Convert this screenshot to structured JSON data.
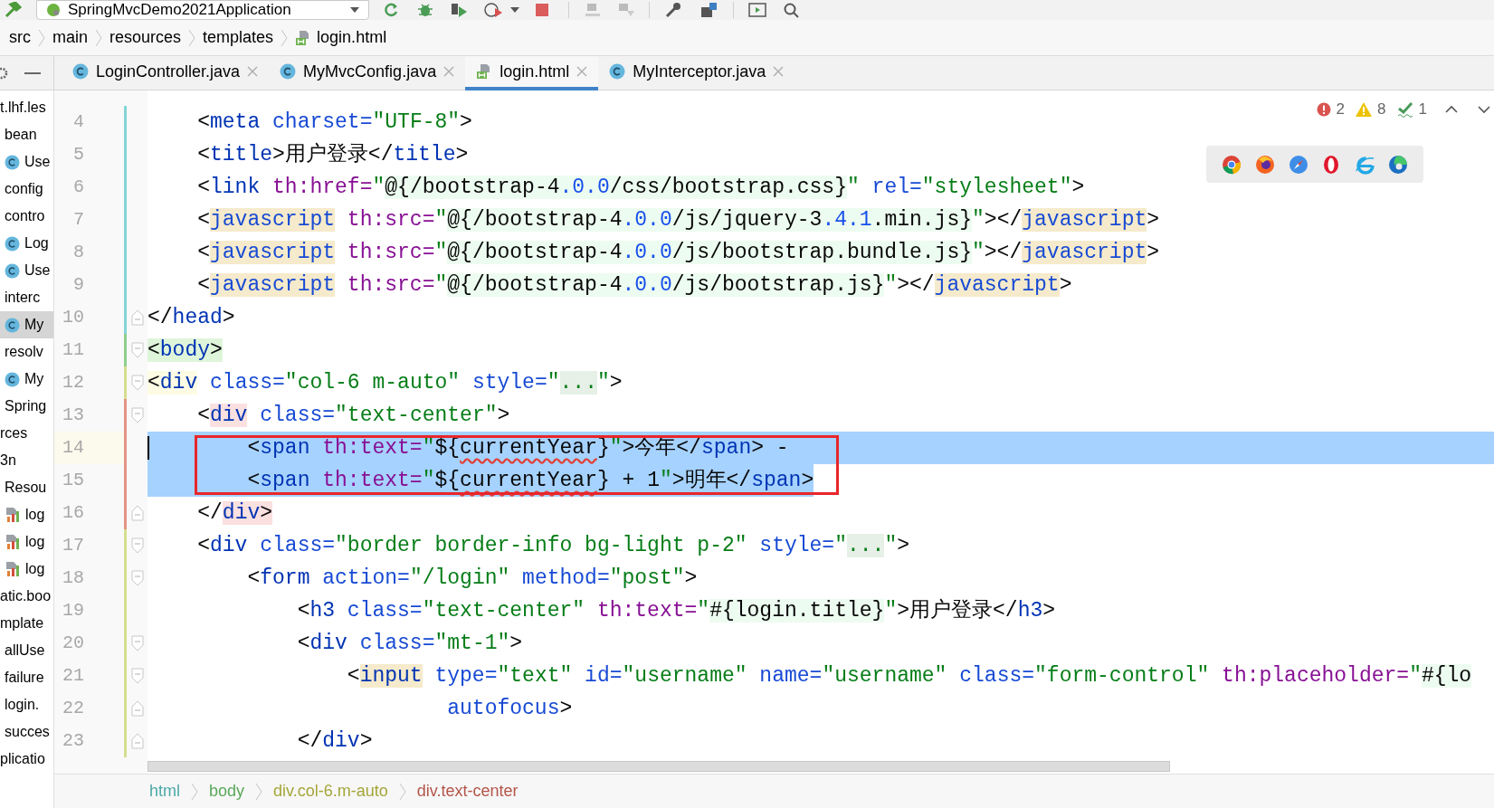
{
  "toolbar": {
    "run_config": "SpringMvcDemo2021Application"
  },
  "breadcrumb": [
    {
      "label": "src",
      "kind": "folder"
    },
    {
      "label": "main",
      "kind": "folder"
    },
    {
      "label": "resources",
      "kind": "folder"
    },
    {
      "label": "templates",
      "kind": "folder"
    },
    {
      "label": "login.html",
      "kind": "html"
    }
  ],
  "tabs": [
    {
      "label": "LoginController.java",
      "kind": "class",
      "selected": false
    },
    {
      "label": "MyMvcConfig.java",
      "kind": "class",
      "selected": false
    },
    {
      "label": "login.html",
      "kind": "html",
      "selected": true
    },
    {
      "label": "MyInterceptor.java",
      "kind": "class",
      "selected": false
    }
  ],
  "project_tree": [
    {
      "label": "t.lhf.les",
      "kind": "folder",
      "selected": false,
      "children": [
        {
          "label": "bean",
          "kind": "folder",
          "selected": false
        },
        {
          "label": "Use",
          "kind": "class",
          "selected": false
        },
        {
          "label": "config",
          "kind": "folder",
          "selected": false
        },
        {
          "label": "contro",
          "kind": "folder",
          "selected": false
        },
        {
          "label": "Log",
          "kind": "class",
          "selected": false
        },
        {
          "label": "Use",
          "kind": "class",
          "selected": false
        },
        {
          "label": "interc",
          "kind": "folder",
          "selected": false
        },
        {
          "label": "My",
          "kind": "class",
          "selected": true
        },
        {
          "label": "resolv",
          "kind": "folder",
          "selected": false
        },
        {
          "label": "My",
          "kind": "class",
          "selected": false
        },
        {
          "label": "Spring",
          "kind": "folder",
          "selected": false
        }
      ]
    },
    {
      "label": "rces",
      "kind": "folder",
      "selected": false
    },
    {
      "label": "3n",
      "kind": "folder",
      "selected": false,
      "children": [
        {
          "label": "Resou",
          "kind": "folder",
          "selected": false
        },
        {
          "label": "log",
          "kind": "log",
          "selected": false
        },
        {
          "label": "log",
          "kind": "log",
          "selected": false
        },
        {
          "label": "log",
          "kind": "log",
          "selected": false
        }
      ]
    },
    {
      "label": "atic.boo",
      "kind": "folder",
      "selected": false
    },
    {
      "label": "mplate",
      "kind": "folder",
      "selected": false,
      "children": [
        {
          "label": "allUse",
          "kind": "folder",
          "selected": false
        },
        {
          "label": "failure",
          "kind": "folder",
          "selected": false
        },
        {
          "label": "login.",
          "kind": "folder",
          "selected": false
        },
        {
          "label": "succes",
          "kind": "folder",
          "selected": false
        }
      ]
    },
    {
      "label": "plicatio",
      "kind": "folder",
      "selected": false
    }
  ],
  "inspections": {
    "errors": "2",
    "warnings": "8",
    "typos": "1"
  },
  "editor": {
    "lines": [
      {
        "number": "4",
        "kind": "modified",
        "fold_open": false,
        "fold_close": false,
        "selected": false,
        "caret": false,
        "framed": false,
        "tokens": [
          {
            "text": "    <",
            "kind": "plain"
          },
          {
            "text": "meta",
            "kind": "tag"
          },
          {
            "text": " charset=",
            "kind": "attr"
          },
          {
            "text": "\"UTF-8\"",
            "kind": "str"
          },
          {
            "text": ">",
            "kind": "plain"
          }
        ]
      },
      {
        "number": "5",
        "kind": "modified",
        "fold_open": false,
        "fold_close": false,
        "selected": false,
        "caret": false,
        "framed": false,
        "tokens": [
          {
            "text": "    <",
            "kind": "plain"
          },
          {
            "text": "title",
            "kind": "tag"
          },
          {
            "text": ">用户登录</",
            "kind": "plain"
          },
          {
            "text": "title",
            "kind": "tag"
          },
          {
            "text": ">",
            "kind": "plain"
          }
        ]
      },
      {
        "number": "6",
        "kind": "modified",
        "fold_open": false,
        "fold_close": false,
        "selected": false,
        "caret": false,
        "framed": false,
        "tokens": [
          {
            "text": "    <",
            "kind": "plain"
          },
          {
            "text": "link",
            "kind": "tag"
          },
          {
            "text": " th:href=",
            "kind": "th"
          },
          {
            "text": "\"",
            "kind": "str"
          },
          {
            "text": "@{/bootstrap-4",
            "kind": "inject"
          },
          {
            "text": ".0.0",
            "kind": "injectnum"
          },
          {
            "text": "/css/bootstrap.css}",
            "kind": "inject"
          },
          {
            "text": "\"",
            "kind": "str"
          },
          {
            "text": " rel=",
            "kind": "attr"
          },
          {
            "text": "\"stylesheet\"",
            "kind": "str"
          },
          {
            "text": ">",
            "kind": "plain"
          }
        ]
      },
      {
        "number": "7",
        "kind": "modified",
        "fold_open": false,
        "fold_close": false,
        "selected": false,
        "caret": false,
        "framed": false,
        "tokens": [
          {
            "text": "    <",
            "kind": "plain"
          },
          {
            "text": "javascript",
            "kind": "unknowntag"
          },
          {
            "text": " th:src=",
            "kind": "th"
          },
          {
            "text": "\"",
            "kind": "str"
          },
          {
            "text": "@{/bootstrap-4",
            "kind": "inject"
          },
          {
            "text": ".0.0",
            "kind": "injectnum"
          },
          {
            "text": "/js/jquery-3",
            "kind": "inject"
          },
          {
            "text": ".4.1",
            "kind": "injectnum"
          },
          {
            "text": ".min.js}",
            "kind": "inject"
          },
          {
            "text": "\"",
            "kind": "str"
          },
          {
            "text": "></",
            "kind": "plain"
          },
          {
            "text": "javascript",
            "kind": "unknowntag"
          },
          {
            "text": ">",
            "kind": "plain"
          }
        ]
      },
      {
        "number": "8",
        "kind": "modified",
        "fold_open": false,
        "fold_close": false,
        "selected": false,
        "caret": false,
        "framed": false,
        "tokens": [
          {
            "text": "    <",
            "kind": "plain"
          },
          {
            "text": "javascript",
            "kind": "unknowntag"
          },
          {
            "text": " th:src=",
            "kind": "th"
          },
          {
            "text": "\"",
            "kind": "str"
          },
          {
            "text": "@{/bootstrap-4",
            "kind": "inject"
          },
          {
            "text": ".0.0",
            "kind": "injectnum"
          },
          {
            "text": "/js/bootstrap.bundle.js}",
            "kind": "inject"
          },
          {
            "text": "\"",
            "kind": "str"
          },
          {
            "text": "></",
            "kind": "plain"
          },
          {
            "text": "javascript",
            "kind": "unknowntag"
          },
          {
            "text": ">",
            "kind": "plain"
          }
        ]
      },
      {
        "number": "9",
        "kind": "modified",
        "fold_open": false,
        "fold_close": false,
        "selected": false,
        "caret": false,
        "framed": false,
        "tokens": [
          {
            "text": "    <",
            "kind": "plain"
          },
          {
            "text": "javascript",
            "kind": "unknowntag"
          },
          {
            "text": " th:src=",
            "kind": "th"
          },
          {
            "text": "\"",
            "kind": "str"
          },
          {
            "text": "@{/bootstrap-4",
            "kind": "inject"
          },
          {
            "text": ".0.0",
            "kind": "injectnum"
          },
          {
            "text": "/js/bootstrap.js}",
            "kind": "inject"
          },
          {
            "text": "\"",
            "kind": "str"
          },
          {
            "text": "></",
            "kind": "plain"
          },
          {
            "text": "javascript",
            "kind": "unknowntag"
          },
          {
            "text": ">",
            "kind": "plain"
          }
        ]
      },
      {
        "number": "10",
        "kind": "modified",
        "fold_open": false,
        "fold_close": true,
        "selected": false,
        "caret": false,
        "framed": false,
        "tokens": [
          {
            "text": "</",
            "kind": "plain"
          },
          {
            "text": "head",
            "kind": "tag"
          },
          {
            "text": ">",
            "kind": "plain"
          }
        ]
      },
      {
        "number": "11",
        "kind": "added",
        "fold_open": true,
        "fold_close": false,
        "selected": false,
        "caret": false,
        "framed": false,
        "tokens": [
          {
            "text": "<",
            "kind": "matched"
          },
          {
            "text": "body",
            "kind": "matchedtag"
          },
          {
            "text": ">",
            "kind": "matched"
          }
        ]
      },
      {
        "number": "12",
        "kind": "changed",
        "fold_open": true,
        "fold_close": false,
        "selected": false,
        "caret": false,
        "framed": false,
        "tokens": [
          {
            "text": "<",
            "kind": "paired"
          },
          {
            "text": "div",
            "kind": "pairedtag"
          },
          {
            "text": " class=",
            "kind": "attr"
          },
          {
            "text": "\"col-6 m-auto\"",
            "kind": "str"
          },
          {
            "text": " style=",
            "kind": "attr"
          },
          {
            "text": "\"",
            "kind": "str"
          },
          {
            "text": "...",
            "kind": "folded"
          },
          {
            "text": "\"",
            "kind": "str"
          },
          {
            "text": ">",
            "kind": "plain"
          }
        ]
      },
      {
        "number": "13",
        "kind": "removed",
        "fold_open": true,
        "fold_close": false,
        "selected": false,
        "caret": false,
        "framed": false,
        "tokens": [
          {
            "text": "    <",
            "kind": "plain"
          },
          {
            "text": "div",
            "kind": "unmatchedtag"
          },
          {
            "text": " class=",
            "kind": "attr"
          },
          {
            "text": "\"text-center\"",
            "kind": "str"
          },
          {
            "text": ">",
            "kind": "plain"
          }
        ]
      },
      {
        "number": "14",
        "kind": "removed",
        "fold_open": false,
        "fold_close": false,
        "selected": true,
        "caret": true,
        "framed": true,
        "tokens": [
          {
            "text": "        <",
            "kind": "plain"
          },
          {
            "text": "span",
            "kind": "tag"
          },
          {
            "text": " th:text=",
            "kind": "th"
          },
          {
            "text": "\"",
            "kind": "str"
          },
          {
            "text": "${",
            "kind": "plain"
          },
          {
            "text": "currentYear",
            "kind": "typo"
          },
          {
            "text": "}",
            "kind": "plain"
          },
          {
            "text": "\"",
            "kind": "str"
          },
          {
            "text": ">今年</",
            "kind": "plain"
          },
          {
            "text": "span",
            "kind": "tag"
          },
          {
            "text": "> -",
            "kind": "plain"
          }
        ]
      },
      {
        "number": "15",
        "kind": "removed",
        "fold_open": false,
        "fold_close": false,
        "selected": true,
        "caret": false,
        "framed": true,
        "tokens": [
          {
            "text": "        <",
            "kind": "plain"
          },
          {
            "text": "span",
            "kind": "tag"
          },
          {
            "text": " th:text=",
            "kind": "th"
          },
          {
            "text": "\"",
            "kind": "str"
          },
          {
            "text": "${",
            "kind": "plain"
          },
          {
            "text": "currentYear",
            "kind": "typo"
          },
          {
            "text": "} + 1",
            "kind": "plain"
          },
          {
            "text": "\"",
            "kind": "str"
          },
          {
            "text": ">明年</",
            "kind": "plain"
          },
          {
            "text": "span",
            "kind": "tag"
          },
          {
            "text": ">",
            "kind": "plain"
          }
        ]
      },
      {
        "number": "16",
        "kind": "removed",
        "fold_open": false,
        "fold_close": true,
        "selected": false,
        "caret": false,
        "framed": false,
        "tokens": [
          {
            "text": "    </",
            "kind": "plain"
          },
          {
            "text": "div",
            "kind": "unmatchedtag"
          },
          {
            "text": ">",
            "kind": "unmatched"
          }
        ]
      },
      {
        "number": "17",
        "kind": "changed",
        "fold_open": true,
        "fold_close": false,
        "selected": false,
        "caret": false,
        "framed": false,
        "tokens": [
          {
            "text": "    <",
            "kind": "plain"
          },
          {
            "text": "div",
            "kind": "tag"
          },
          {
            "text": " class=",
            "kind": "attr"
          },
          {
            "text": "\"border border-info bg-light p-2\"",
            "kind": "str"
          },
          {
            "text": " style=",
            "kind": "attr"
          },
          {
            "text": "\"",
            "kind": "str"
          },
          {
            "text": "...",
            "kind": "folded"
          },
          {
            "text": "\"",
            "kind": "str"
          },
          {
            "text": ">",
            "kind": "plain"
          }
        ]
      },
      {
        "number": "18",
        "kind": "changed",
        "fold_open": true,
        "fold_close": false,
        "selected": false,
        "caret": false,
        "framed": false,
        "tokens": [
          {
            "text": "        <",
            "kind": "plain"
          },
          {
            "text": "form",
            "kind": "tag"
          },
          {
            "text": " action=",
            "kind": "attr"
          },
          {
            "text": "\"/login\"",
            "kind": "str"
          },
          {
            "text": " method=",
            "kind": "attr"
          },
          {
            "text": "\"post\"",
            "kind": "str"
          },
          {
            "text": ">",
            "kind": "plain"
          }
        ]
      },
      {
        "number": "19",
        "kind": "changed",
        "fold_open": false,
        "fold_close": false,
        "selected": false,
        "caret": false,
        "framed": false,
        "tokens": [
          {
            "text": "            <",
            "kind": "plain"
          },
          {
            "text": "h3",
            "kind": "tag"
          },
          {
            "text": " class=",
            "kind": "attr"
          },
          {
            "text": "\"text-center\"",
            "kind": "str"
          },
          {
            "text": " th:text=",
            "kind": "th"
          },
          {
            "text": "\"",
            "kind": "str"
          },
          {
            "text": "#{login.title}",
            "kind": "inject"
          },
          {
            "text": "\"",
            "kind": "str"
          },
          {
            "text": ">用户登录</",
            "kind": "plain"
          },
          {
            "text": "h3",
            "kind": "tag"
          },
          {
            "text": ">",
            "kind": "plain"
          }
        ]
      },
      {
        "number": "20",
        "kind": "changed",
        "fold_open": true,
        "fold_close": false,
        "selected": false,
        "caret": false,
        "framed": false,
        "tokens": [
          {
            "text": "            <",
            "kind": "plain"
          },
          {
            "text": "div",
            "kind": "tag"
          },
          {
            "text": " class=",
            "kind": "attr"
          },
          {
            "text": "\"mt-1\"",
            "kind": "str"
          },
          {
            "text": ">",
            "kind": "plain"
          }
        ]
      },
      {
        "number": "21",
        "kind": "changed",
        "fold_open": true,
        "fold_close": false,
        "selected": false,
        "caret": false,
        "framed": false,
        "tokens": [
          {
            "text": "                <",
            "kind": "plain"
          },
          {
            "text": "input",
            "kind": "unknowninput"
          },
          {
            "text": " type=",
            "kind": "attr"
          },
          {
            "text": "\"text\"",
            "kind": "str"
          },
          {
            "text": " id=",
            "kind": "attr"
          },
          {
            "text": "\"username\"",
            "kind": "str"
          },
          {
            "text": " name=",
            "kind": "attr"
          },
          {
            "text": "\"username\"",
            "kind": "str"
          },
          {
            "text": " class=",
            "kind": "attr"
          },
          {
            "text": "\"form-control\"",
            "kind": "str"
          },
          {
            "text": " th:placeholder=",
            "kind": "th"
          },
          {
            "text": "\"",
            "kind": "str"
          },
          {
            "text": "#{lo",
            "kind": "inject"
          }
        ]
      },
      {
        "number": "22",
        "kind": "changed",
        "fold_open": false,
        "fold_close": true,
        "selected": false,
        "caret": false,
        "framed": false,
        "tokens": [
          {
            "text": "                        autofocus",
            "kind": "attr"
          },
          {
            "text": ">",
            "kind": "plain"
          }
        ]
      },
      {
        "number": "23",
        "kind": "changed",
        "fold_open": false,
        "fold_close": true,
        "selected": false,
        "caret": false,
        "framed": false,
        "tokens": [
          {
            "text": "            </",
            "kind": "plain"
          },
          {
            "text": "div",
            "kind": "tag"
          },
          {
            "text": ">",
            "kind": "plain"
          }
        ]
      }
    ]
  },
  "path": [
    {
      "label": "html",
      "color": "#4ea9a8"
    },
    {
      "label": "body",
      "color": "#5aa85a"
    },
    {
      "label": "div.col-6.m-auto",
      "color": "#a5a53a"
    },
    {
      "label": "div.text-center",
      "color": "#b4554a"
    }
  ]
}
